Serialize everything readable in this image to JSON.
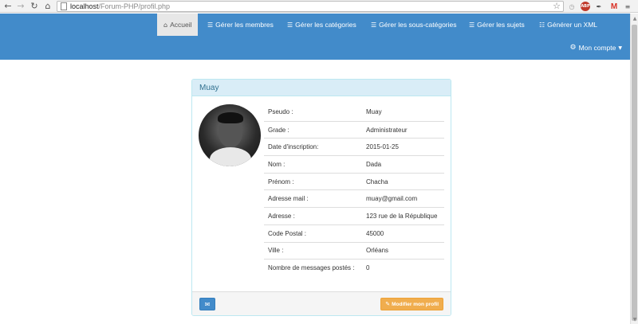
{
  "browser": {
    "url_host": "localhost",
    "url_path": "/Forum-PHP/profil.php",
    "extensions": [
      {
        "name": "clock-icon",
        "glyph": "◷",
        "color": "#9e9e9e",
        "bg": "transparent"
      },
      {
        "name": "adblock-icon",
        "glyph": "ABP",
        "color": "#ffffff",
        "bg": "#c0392b"
      },
      {
        "name": "eyedropper-icon",
        "glyph": "✒",
        "color": "#444444",
        "bg": "transparent"
      },
      {
        "name": "gmail-icon",
        "glyph": "M",
        "color": "#d93025",
        "bg": "transparent"
      },
      {
        "name": "menu-icon",
        "glyph": "≡",
        "color": "#555555",
        "bg": "transparent"
      }
    ]
  },
  "navbar": {
    "color": "#428bca",
    "items": [
      {
        "label": "Accueil",
        "icon": "home-icon",
        "active": true
      },
      {
        "label": "Gérer les membres",
        "icon": "list-icon"
      },
      {
        "label": "Gérer les catégories",
        "icon": "list-icon"
      },
      {
        "label": "Gérer les sous-catégories",
        "icon": "list-icon"
      },
      {
        "label": "Gérer les sujets",
        "icon": "list-icon"
      },
      {
        "label": "Générer un XML",
        "icon": "xml-icon"
      }
    ],
    "account": {
      "label": "Mon compte",
      "icon": "gear-icon"
    }
  },
  "profile": {
    "title": "Muay",
    "fields": [
      {
        "label": "Pseudo :",
        "value": "Muay"
      },
      {
        "label": "Grade :",
        "value": "Administrateur"
      },
      {
        "label": "Date d'inscription:",
        "value": "2015-01-25"
      },
      {
        "label": "Nom :",
        "value": "Dada"
      },
      {
        "label": "Prénom :",
        "value": "Chacha"
      },
      {
        "label": "Adresse mail :",
        "value": "muay@gmail.com"
      },
      {
        "label": "Adresse :",
        "value": "123 rue de la République"
      },
      {
        "label": "Code Postal :",
        "value": "45000"
      },
      {
        "label": "Ville :",
        "value": "Orléans"
      },
      {
        "label": "Nombre de messages postés :",
        "value": "0"
      }
    ],
    "edit_button": "Modifier mon profil"
  }
}
